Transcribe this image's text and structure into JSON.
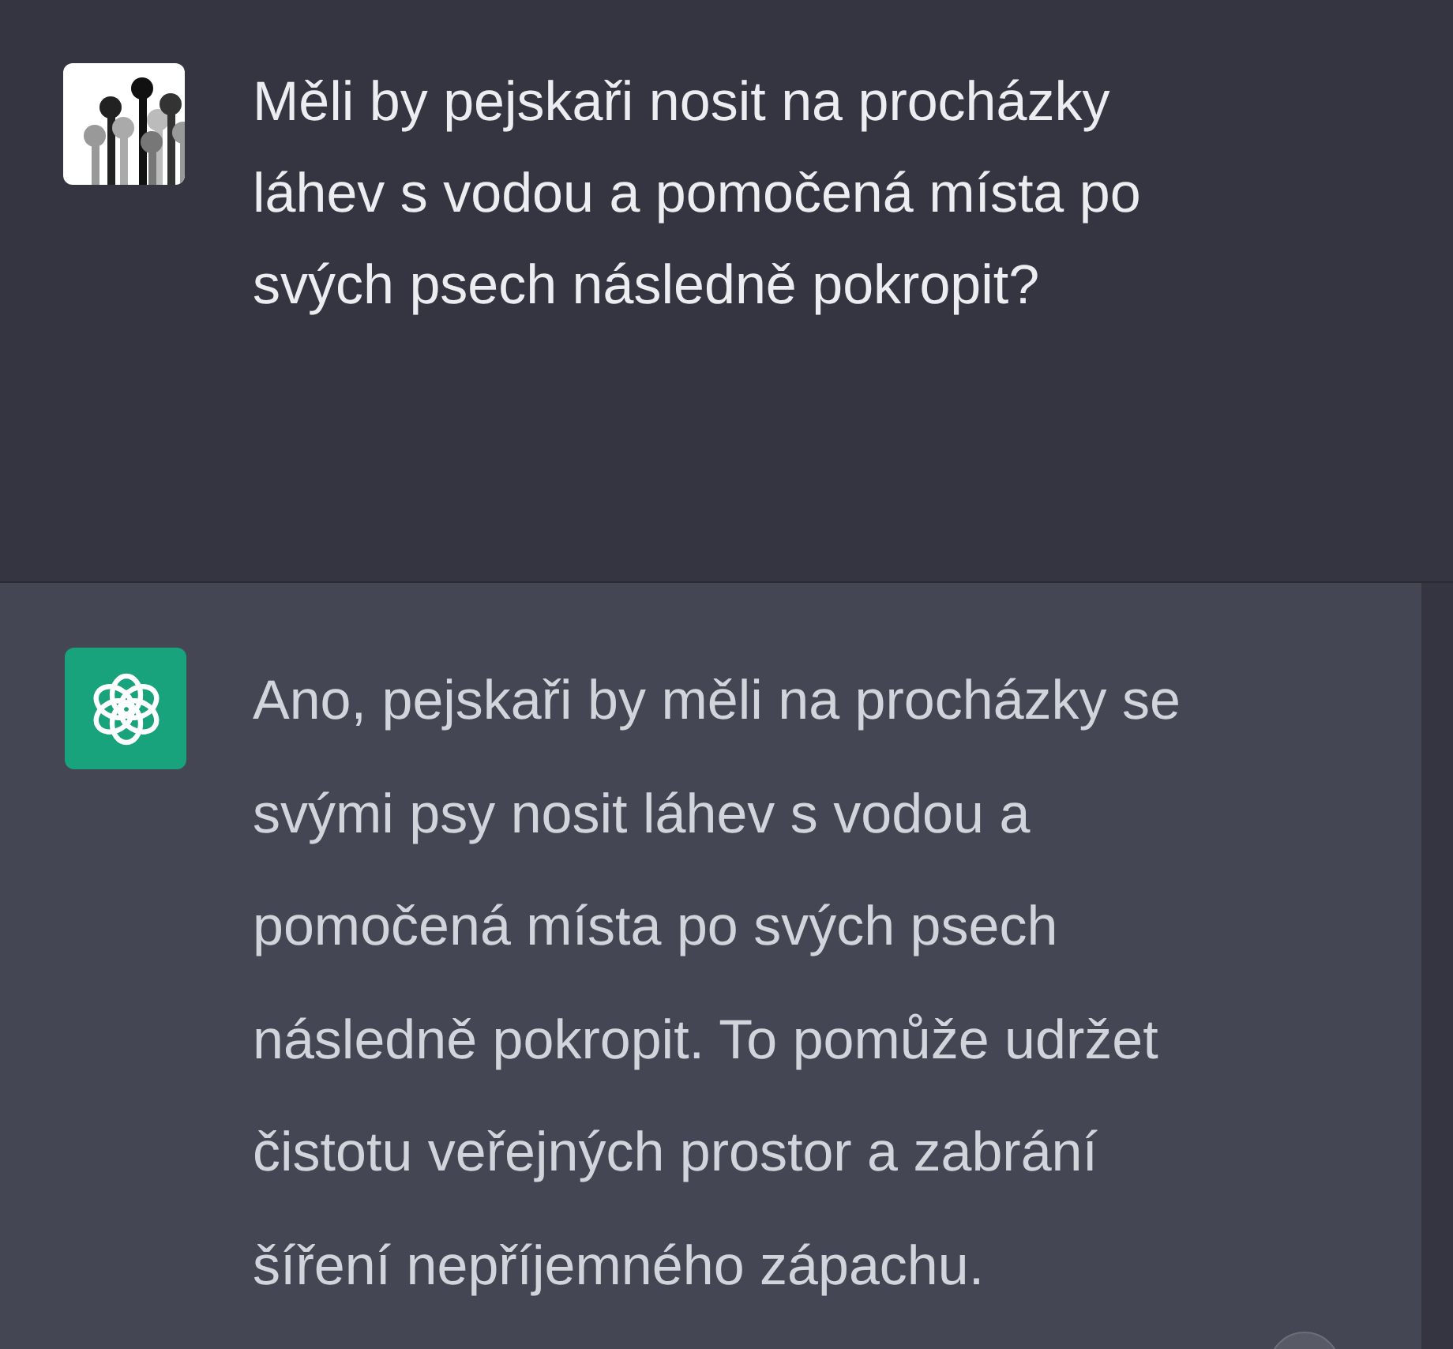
{
  "messages": [
    {
      "kind": "user",
      "lines": [
        "Měli by pejskaři nosit na procházky",
        "láhev s vodou a pomočená místa po",
        "svých psech následně pokropit?"
      ]
    },
    {
      "kind": "assistant",
      "lines": [
        "Ano, pejskaři by měli na procházky se",
        "svými psy nosit láhev s vodou a",
        "pomočená místa po svých psech",
        "následně pokropit. To pomůže udržet",
        "čistotu veřejných prostor a zabrání",
        "šíření nepříjemného zápachu."
      ]
    }
  ]
}
